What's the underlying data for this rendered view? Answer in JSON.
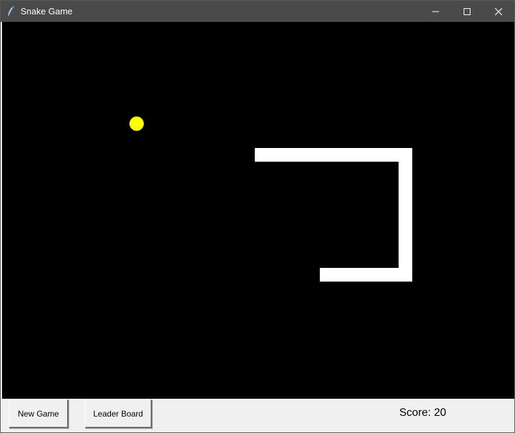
{
  "window": {
    "title": "Snake Game",
    "icon": "feather-icon",
    "controls": {
      "minimize_icon": "minimize-icon",
      "maximize_icon": "maximize-icon",
      "close_icon": "close-icon"
    }
  },
  "game": {
    "background_color": "#000000",
    "food_color": "#ffff00",
    "snake_color": "#ffffff"
  },
  "controls": {
    "new_game_label": "New Game",
    "leader_board_label": "Leader Board"
  },
  "score_text": "Score: 20"
}
